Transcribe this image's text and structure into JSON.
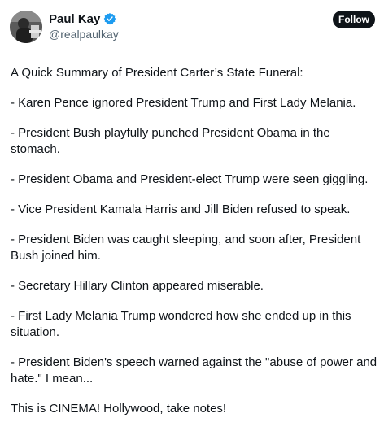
{
  "author": {
    "display_name": "Paul Kay",
    "handle": "@realpaulkay",
    "verified": true,
    "verified_color": "#1d9bf0"
  },
  "follow_label": "Follow",
  "paragraphs": [
    "A Quick Summary of President Carter’s State Funeral:",
    "- Karen Pence ignored President Trump and First Lady Melania.",
    "- President Bush playfully punched President Obama in the stomach.",
    "- President Obama and President-elect Trump were seen giggling.",
    "- Vice President Kamala Harris and Jill Biden refused to speak.",
    "- President Biden was caught sleeping, and soon after, President Bush joined him.",
    "- Secretary Hillary Clinton appeared miserable.",
    "- First Lady Melania Trump wondered how she ended up in this situation.",
    "- President Biden's speech warned against the \"abuse of power and hate.\" I mean...",
    "This is CINEMA! Hollywood, take notes!"
  ]
}
